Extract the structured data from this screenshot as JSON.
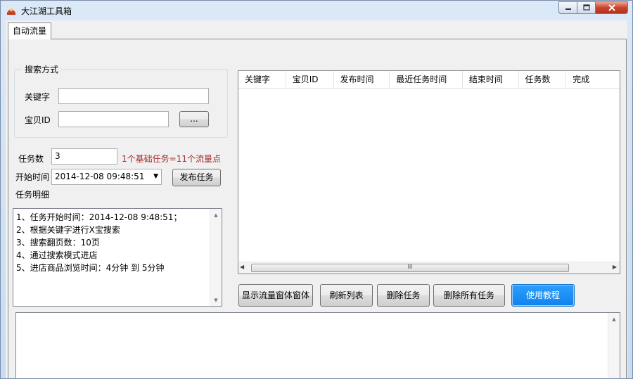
{
  "window": {
    "title": "大江湖工具箱"
  },
  "tabs": [
    {
      "label": "自动流量"
    }
  ],
  "search_group": {
    "legend": "搜索方式",
    "keyword_label": "关键字",
    "keyword_value": "",
    "item_id_label": "宝贝ID",
    "item_id_value": "",
    "browse_label": "..."
  },
  "task": {
    "count_label": "任务数",
    "count_value": "3",
    "hint": "1个基础任务=11个流量点",
    "start_time_label": "开始时间",
    "start_time_value": "2014-12-08 09:48:51",
    "publish_label": "发布任务",
    "detail_label": "任务明细",
    "detail_lines": [
      "1、任务开始时间：2014-12-08 9:48:51；",
      "2、根据关键字进行X宝搜索",
      "3、搜索翻页数：10页",
      "4、通过搜索模式进店",
      "5、进店商品浏览时间：4分钟 到 5分钟"
    ]
  },
  "table": {
    "columns": [
      "关键字",
      "宝贝ID",
      "发布时间",
      "最近任务时间",
      "结束时间",
      "任务数",
      "完成"
    ],
    "rows": [],
    "hscroll_grip": "III"
  },
  "actions": {
    "show_window": "显示流量窗体窗体",
    "refresh": "刷新列表",
    "delete": "删除任务",
    "delete_all": "删除所有任务",
    "tutorial": "使用教程"
  },
  "log": {
    "text": ""
  }
}
